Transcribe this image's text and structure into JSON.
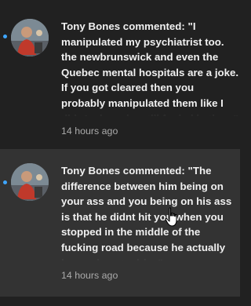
{
  "colors": {
    "background": "#212121",
    "highlight_row": "#333333",
    "unread_dot": "#3ea6ff",
    "text": "#f1f1f1",
    "secondary_text": "#aaaaaa"
  },
  "notifications": [
    {
      "text": "Tony Bones commented: \"I manipulated my psychiatrist too. the newbrunswick and even the Quebec mental hospitals are a joke. If you got cleared then you probably manipulated them like I did. And maybe still fooled in them\"",
      "timestamp": "14 hours ago",
      "unread": true,
      "avatar_icon": "user-avatar"
    },
    {
      "text": "Tony Bones commented: \"The difference between him being on your ass and you being on his ass is that he didnt hit you when you stopped in the middle of the fucking road because he actually knows how to drive\"",
      "timestamp": "14 hours ago",
      "unread": true,
      "avatar_icon": "user-avatar"
    }
  ],
  "cursor_icon": "hand-pointer-icon"
}
